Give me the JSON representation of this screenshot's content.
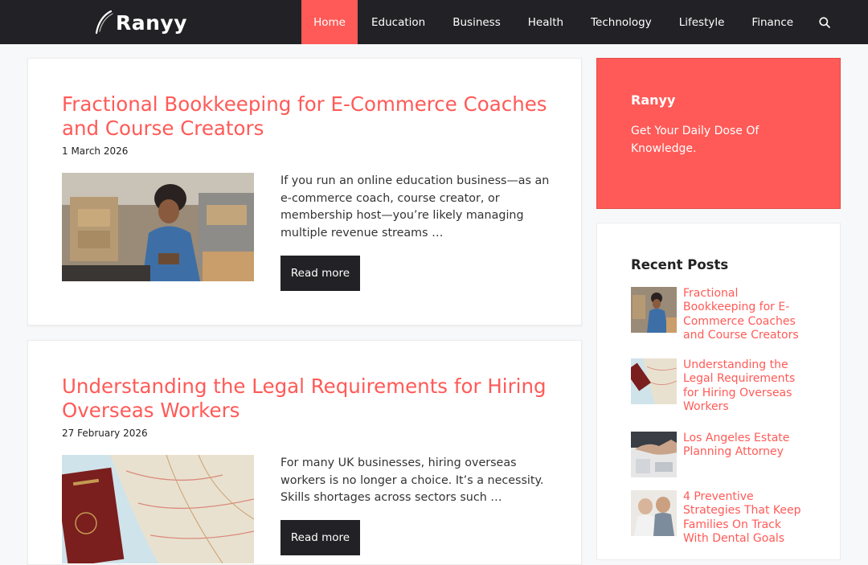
{
  "site": {
    "name": "Ranyy"
  },
  "nav": {
    "items": [
      "Home",
      "Education",
      "Business",
      "Health",
      "Technology",
      "Lifestyle",
      "Finance"
    ],
    "active_index": 0,
    "search_icon": "search-icon"
  },
  "posts": [
    {
      "title": "Fractional Bookkeeping for E-Commerce Coaches and Course Creators",
      "date": "1 March 2026",
      "excerpt": "If you run an online education business—as an e-commerce coach, course creator, or membership host—you’re likely managing multiple revenue streams …",
      "button": "Read more"
    },
    {
      "title": "Understanding the Legal Requirements for Hiring Overseas Workers",
      "date": "27 February 2026",
      "excerpt": "For many UK businesses, hiring overseas workers is no longer a choice. It’s a necessity. Skills shortages across sectors such …",
      "button": "Read more"
    }
  ],
  "sidebar": {
    "promo": {
      "title": "Ranyy",
      "text": "Get Your Daily Dose Of Knowledge."
    },
    "recent": {
      "heading": "Recent Posts",
      "items": [
        "Fractional Bookkeeping for E-Commerce Coaches and Course Creators",
        "Understanding the Legal Requirements for Hiring Overseas Workers",
        "Los Angeles Estate Planning Attorney",
        "4 Preventive Strategies That Keep Families On Track With Dental Goals"
      ]
    }
  },
  "colors": {
    "accent": "#ff5a57",
    "header_bg": "#222226",
    "page_bg": "#f7f8f9"
  }
}
